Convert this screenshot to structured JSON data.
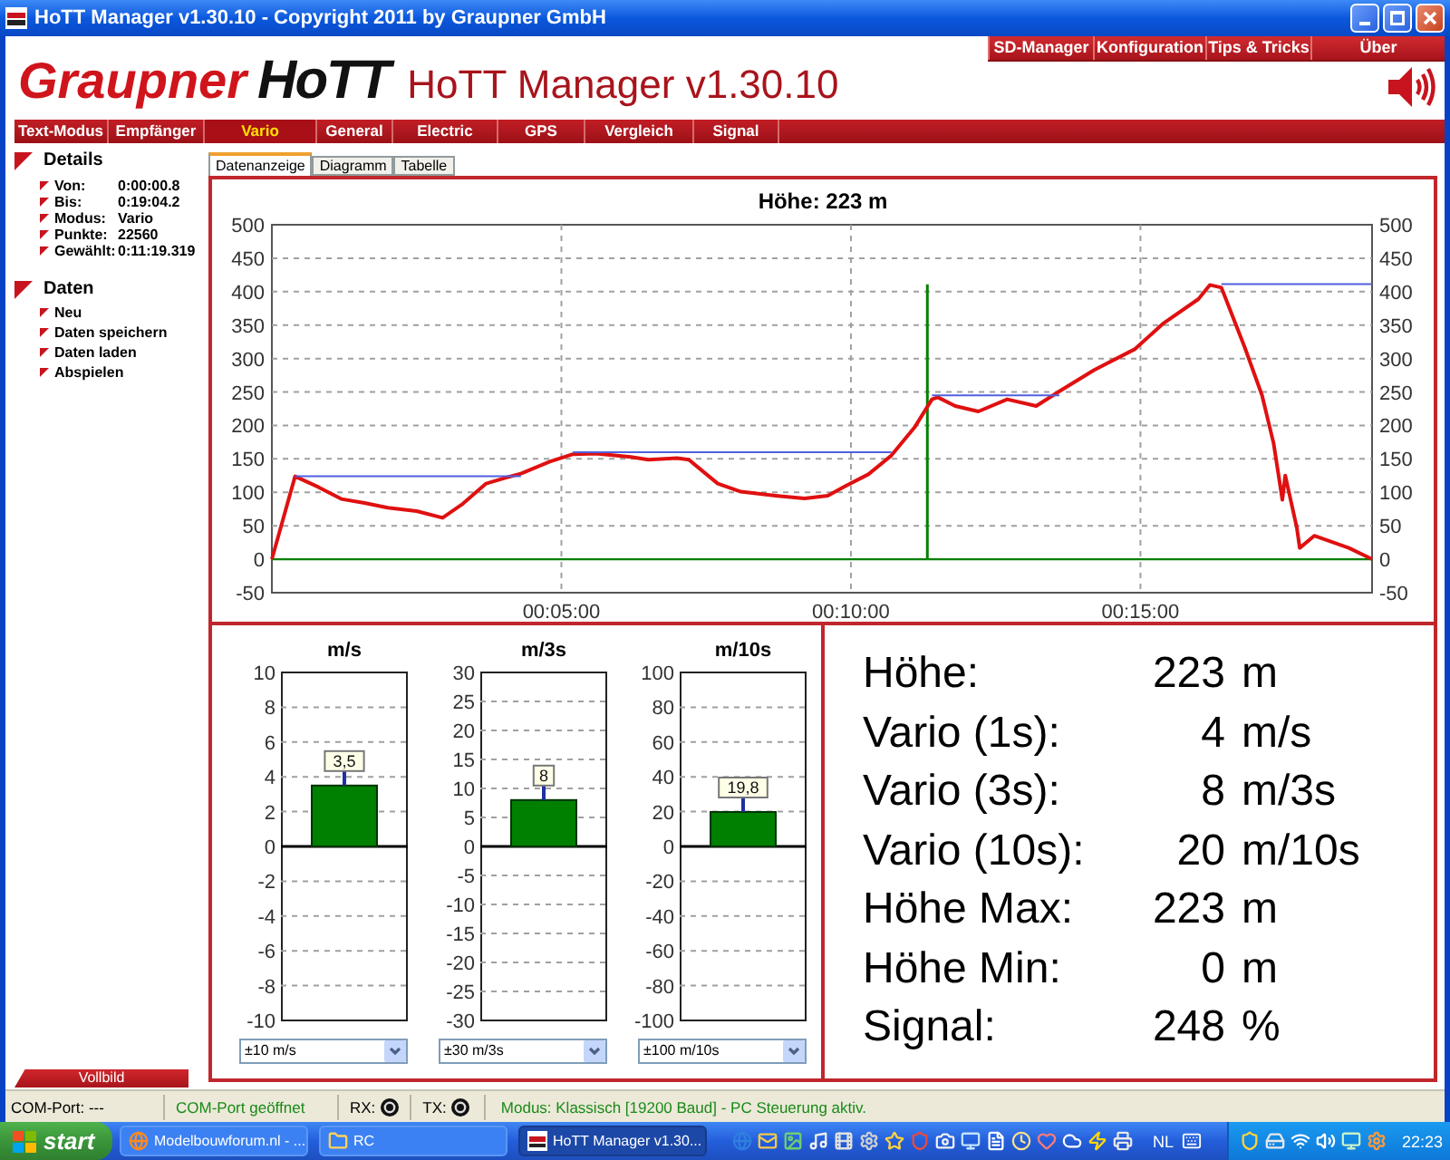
{
  "window": {
    "title": "HoTT Manager v1.30.10 - Copyright 2011 by Graupner GmbH"
  },
  "header": {
    "brand": "Graupner",
    "logo": "HoTT",
    "app_title": "HoTT Manager v1.30.10",
    "top_menu": [
      "SD-Manager",
      "Konfiguration",
      "Tips & Tricks",
      "Über"
    ]
  },
  "nav_tabs": [
    {
      "label": "Text-Modus",
      "selected": false
    },
    {
      "label": "Empfänger",
      "selected": false
    },
    {
      "label": "Vario",
      "selected": true
    },
    {
      "label": "General",
      "selected": false
    },
    {
      "label": "Electric",
      "selected": false
    },
    {
      "label": "GPS",
      "selected": false
    },
    {
      "label": "Vergleich",
      "selected": false
    },
    {
      "label": "Signal",
      "selected": false
    }
  ],
  "sidebar": {
    "sections": [
      {
        "title": "Details",
        "items": [
          {
            "label": "Von:",
            "value": "0:00:00.8"
          },
          {
            "label": "Bis:",
            "value": "0:19:04.2"
          },
          {
            "label": "Modus:",
            "value": "Vario"
          },
          {
            "label": "Punkte:",
            "value": "22560"
          },
          {
            "label": "Gewählt:",
            "value": "0:11:19.319"
          }
        ]
      },
      {
        "title": "Daten",
        "items": [
          {
            "label": "Neu"
          },
          {
            "label": "Daten speichern"
          },
          {
            "label": "Daten laden"
          },
          {
            "label": "Abspielen"
          }
        ]
      }
    ],
    "fullscreen_button": "Vollbild"
  },
  "view_tabs": [
    {
      "label": "Datenanzeige",
      "selected": true
    },
    {
      "label": "Diagramm",
      "selected": false
    },
    {
      "label": "Tabelle",
      "selected": false
    }
  ],
  "altitude_chart": {
    "chart_data": {
      "type": "line",
      "title": "Höhe: 223 m",
      "x": [
        0,
        0.4,
        0.8,
        1.2,
        1.6,
        2.0,
        2.5,
        2.95,
        3.3,
        3.7,
        4.0,
        4.3,
        4.8,
        5.2,
        5.6,
        6.2,
        6.5,
        7.0,
        7.2,
        7.7,
        8.1,
        8.7,
        9.2,
        9.6,
        9.9,
        10.3,
        10.7,
        11.1,
        11.4,
        11.5,
        11.8,
        12.2,
        12.7,
        13.2,
        13.6,
        14.2,
        14.9,
        15.4,
        16.0,
        16.2,
        16.4,
        16.8,
        17.1,
        17.3,
        17.45,
        17.5,
        17.7,
        17.75,
        18.0,
        18.6,
        19.0
      ],
      "series": [
        {
          "color": "#e01010",
          "values": [
            0,
            124,
            108,
            90,
            84,
            77,
            72,
            62,
            83,
            113,
            121,
            128,
            146,
            157,
            158,
            153,
            149,
            151,
            149,
            113,
            101,
            95,
            91,
            95,
            109,
            127,
            155,
            197,
            239,
            242,
            229,
            221,
            239,
            229,
            251,
            283,
            314,
            353,
            389,
            410,
            406,
            317,
            245,
            173,
            89,
            125,
            47,
            17,
            35,
            17,
            0
          ]
        },
        {
          "color": "#5060e0",
          "values": [
            null,
            124,
            124,
            124,
            124,
            124,
            124,
            124,
            124,
            124,
            124,
            124,
            null,
            160,
            160,
            160,
            160,
            160,
            160,
            160,
            160,
            160,
            160,
            160,
            160,
            160,
            160,
            null,
            245,
            245,
            245,
            245,
            245,
            245,
            245,
            null,
            null,
            null,
            null,
            null,
            411,
            411,
            411,
            411,
            411,
            411,
            411,
            411,
            411,
            411,
            411
          ]
        }
      ],
      "ref_lines": [
        {
          "axis": "y",
          "value": 0,
          "color": "#008000"
        },
        {
          "axis": "x",
          "value": 11.32,
          "color": "#008000"
        }
      ],
      "grid": true,
      "xlim": [
        0,
        19.0
      ],
      "ylim": [
        -50,
        500
      ],
      "xticks": [
        {
          "value": 5,
          "label": "00:05:00"
        },
        {
          "value": 10,
          "label": "00:10:00"
        },
        {
          "value": 15,
          "label": "00:15:00"
        }
      ],
      "yticks": [
        -50,
        0,
        50,
        100,
        150,
        200,
        250,
        300,
        350,
        400,
        450,
        500
      ]
    },
    "right_axis_labels": [
      "500",
      "450",
      "400",
      "350",
      "300",
      "250",
      "200",
      "150",
      "100",
      "50",
      "0",
      "-50"
    ]
  },
  "gauges": [
    {
      "chart_data": {
        "type": "bar",
        "title": "m/s",
        "series": [
          {
            "color": "#008000",
            "values": [
              3.5
            ]
          }
        ],
        "value_labels": [
          "3,5"
        ],
        "grid": true,
        "ylim": [
          -10,
          10
        ],
        "yticks": [
          -10,
          -8,
          -6,
          -4,
          -2,
          0,
          2,
          4,
          6,
          8,
          10
        ]
      },
      "range_select": {
        "value": "±10 m/s"
      }
    },
    {
      "chart_data": {
        "type": "bar",
        "title": "m/3s",
        "series": [
          {
            "color": "#008000",
            "values": [
              8
            ]
          }
        ],
        "value_labels": [
          "8"
        ],
        "grid": true,
        "ylim": [
          -30,
          30
        ],
        "yticks": [
          -30,
          -25,
          -20,
          -15,
          -10,
          -5,
          0,
          5,
          10,
          15,
          20,
          25,
          30
        ]
      },
      "range_select": {
        "value": "±30 m/3s"
      }
    },
    {
      "chart_data": {
        "type": "bar",
        "title": "m/10s",
        "series": [
          {
            "color": "#008000",
            "values": [
              19.8
            ]
          }
        ],
        "value_labels": [
          "19,8"
        ],
        "grid": true,
        "ylim": [
          -100,
          100
        ],
        "yticks": [
          -100,
          -80,
          -60,
          -40,
          -20,
          0,
          20,
          40,
          60,
          80,
          100
        ]
      },
      "range_select": {
        "value": "±100 m/10s"
      }
    }
  ],
  "readings": [
    {
      "label": "Höhe:",
      "value": "223",
      "unit": "m"
    },
    {
      "label": "Vario (1s):",
      "value": "4",
      "unit": "m/s"
    },
    {
      "label": "Vario (3s):",
      "value": "8",
      "unit": "m/3s"
    },
    {
      "label": "Vario (10s):",
      "value": "20",
      "unit": "m/10s"
    },
    {
      "label": "Höhe Max:",
      "value": "223",
      "unit": "m"
    },
    {
      "label": "Höhe Min:",
      "value": "0",
      "unit": "m"
    },
    {
      "label": "Signal:",
      "value": "248",
      "unit": "%"
    }
  ],
  "status_bar": {
    "port": "COM-Port: ---",
    "connection": {
      "text": "COM-Port geöffnet",
      "color": "#1a8a1a"
    },
    "rx": "RX:",
    "tx": "TX:",
    "mode": {
      "text": "Modus: Klassisch [19200 Baud] - PC Steuerung aktiv.",
      "color": "#1a8a1a"
    }
  },
  "taskbar": {
    "start": "start",
    "tasks": [
      {
        "label": "Modelbouwforum.nl - ...",
        "selected": false
      },
      {
        "label": "RC",
        "selected": false
      },
      {
        "label": "HoTT Manager v1.30...",
        "selected": true
      }
    ],
    "language": "NL",
    "clock": "22:23"
  }
}
